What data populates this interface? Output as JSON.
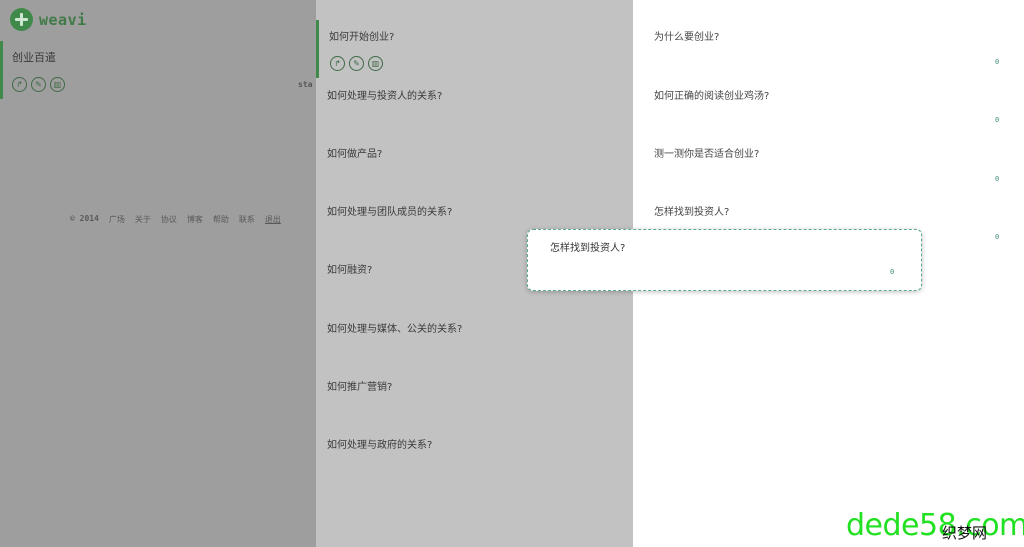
{
  "brand": {
    "name": "weavi"
  },
  "sidebar": {
    "card": {
      "title": "创业百遣"
    },
    "cut_text": "sta",
    "footer": {
      "copyright": "© 2014",
      "links": [
        "广场",
        "关于",
        "协议",
        "博客",
        "帮助",
        "联系"
      ],
      "logout": "退出"
    }
  },
  "middle": {
    "items": [
      {
        "title": "如何开始创业?"
      },
      {
        "title": "如何处理与投资人的关系?"
      },
      {
        "title": "如何做产品?"
      },
      {
        "title": "如何处理与团队成员的关系?"
      },
      {
        "title": "如何融资?"
      },
      {
        "title": "如何处理与媒体、公关的关系?"
      },
      {
        "title": "如何推广营销?"
      },
      {
        "title": "如何处理与政府的关系?"
      }
    ]
  },
  "right": {
    "items": [
      {
        "title": "为什么要创业?",
        "count": "0"
      },
      {
        "title": "如何正确的阅读创业鸡汤?",
        "count": "0"
      },
      {
        "title": "测一测你是否适合创业?",
        "count": "0"
      },
      {
        "title": "怎样找到投资人?",
        "count": "0"
      }
    ]
  },
  "drag_card": {
    "title": "怎样找到投资人?",
    "count": "0"
  },
  "watermark": {
    "text": "dede58.com",
    "overlay": "织梦网"
  },
  "icons": {
    "share": "share-icon",
    "edit": "edit-icon",
    "delete": "delete-icon"
  },
  "colors": {
    "accent": "#3f8a4a",
    "count": "#3a8a7a",
    "watermark": "#22e022"
  }
}
